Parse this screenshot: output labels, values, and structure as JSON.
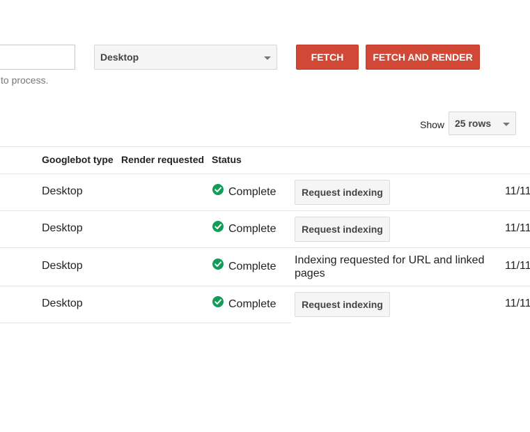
{
  "form": {
    "url_value": "",
    "hint": "to process.",
    "device_select": "Desktop",
    "fetch_label": "FETCH",
    "fetch_render_label": "FETCH AND RENDER"
  },
  "pagination": {
    "show_label": "Show",
    "rows_select": "25 rows"
  },
  "table": {
    "headers": [
      "Googlebot type",
      "Render requested",
      "Status"
    ],
    "rows": [
      {
        "googlebot_type": "Desktop",
        "status": "Complete",
        "action": "Request indexing",
        "date": "11/11"
      },
      {
        "googlebot_type": "Desktop",
        "status": "Complete",
        "action": "Request indexing",
        "date": "11/11"
      },
      {
        "googlebot_type": "Desktop",
        "status": "Complete",
        "indexing_note": "Indexing requested for URL and linked pages",
        "date": "11/11"
      },
      {
        "googlebot_type": "Desktop",
        "status": "Complete",
        "action": "Request indexing",
        "date": "11/11"
      }
    ]
  },
  "icons": {
    "status_check": "check-circle-icon",
    "dropdown": "chevron-down-icon"
  },
  "colors": {
    "accent_red": "#d14836",
    "check_green": "#0f9d58"
  }
}
